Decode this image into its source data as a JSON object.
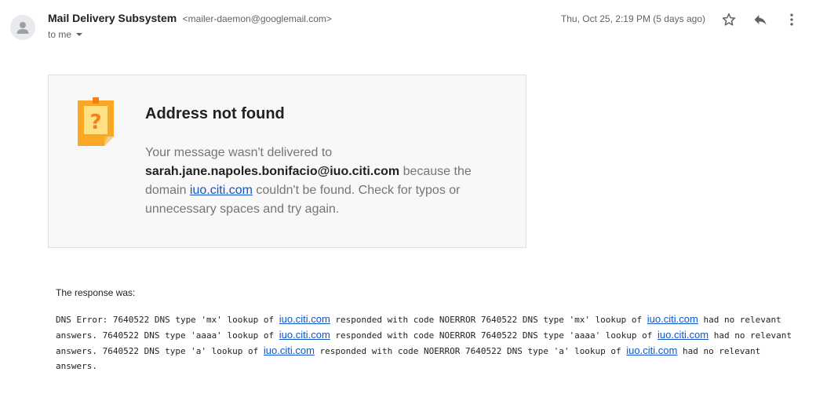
{
  "header": {
    "sender_name": "Mail Delivery Subsystem",
    "sender_email": "<mailer-daemon@googlemail.com>",
    "to_label": "to me",
    "date": "Thu, Oct 25, 2:19 PM (5 days ago)"
  },
  "icons": {
    "avatar": "person-icon",
    "star": "star-icon",
    "reply": "reply-icon",
    "more": "more-vert-icon",
    "card": "question-note-icon"
  },
  "colors": {
    "accent_orange": "#f9a825",
    "link": "#1155cc",
    "card_bg": "#f8f8f8"
  },
  "card": {
    "title": "Address not found",
    "text_1": "Your message wasn't delivered to ",
    "address": "sarah.jane.napoles.bonifacio@iuo.citi.com",
    "text_2": " because the domain ",
    "domain": "iuo.citi.com",
    "text_3": " couldn't be found. Check for typos or unnecessary spaces and try again."
  },
  "response": {
    "label": "The response was:",
    "segments": [
      {
        "text": "DNS Error: 7640522 DNS type 'mx' lookup of "
      },
      {
        "link": "iuo.citi.com"
      },
      {
        "text": " responded with code NOERROR 7640522 DNS type 'mx' lookup of "
      },
      {
        "link": "iuo.citi.com"
      },
      {
        "text": " had no relevant answers. 7640522 DNS type 'aaaa' lookup of "
      },
      {
        "link": "iuo.citi.com"
      },
      {
        "text": " responded with code NOERROR 7640522 DNS type 'aaaa' lookup of "
      },
      {
        "link": "iuo.citi.com"
      },
      {
        "text": " had no relevant answers. 7640522 DNS type 'a' lookup of "
      },
      {
        "link": "iuo.citi.com"
      },
      {
        "text": " responded with code NOERROR 7640522 DNS type 'a' lookup of "
      },
      {
        "link": "iuo.citi.com"
      },
      {
        "text": " had no relevant answers."
      }
    ]
  }
}
